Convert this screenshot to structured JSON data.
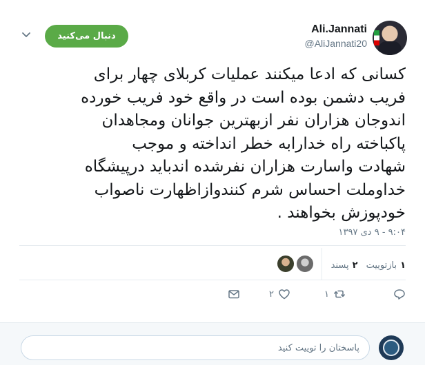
{
  "author": {
    "name": "Ali.Jannati",
    "handle": "@AliJannati20",
    "avatar_icon": "profile-photo"
  },
  "follow_button": {
    "label": "دنبال می‌کنید",
    "color": "#5aaa47"
  },
  "tweet": {
    "text_lines": [
      "کسانی که ادعا میکنند عملیات کربلای چهار برای",
      "فریب دشمن بوده است در واقع خود فریب خورده",
      "اندوجان هزاران نفر ازبهترین جوانان ومجاهدان",
      "پاکباخته راه خدارابه خطر انداخته و موجب",
      "شهادت واسارت هزاران نفرشده اندباید درپیشگاه",
      "خداوملت احساس شرم کنندوازاظهارت ناصواب",
      "خودپوزش بخواهند ."
    ],
    "timestamp": "۹:۰۴ - ۹ دی ۱۳۹۷"
  },
  "stats": {
    "retweets_count": "۱",
    "retweets_label": "بازتوییت",
    "likes_count": "۲",
    "likes_label": "پسند"
  },
  "actions": {
    "reply_icon": "reply-icon",
    "retweet_count": "۱",
    "like_count": "۲",
    "message_icon": "envelope-icon"
  },
  "reply_box": {
    "placeholder": "پاسختان را توییت کنید",
    "avatar_icon": "account-logo"
  },
  "colors": {
    "accent": "#1da1f2",
    "muted": "#657786",
    "text": "#14171a"
  }
}
